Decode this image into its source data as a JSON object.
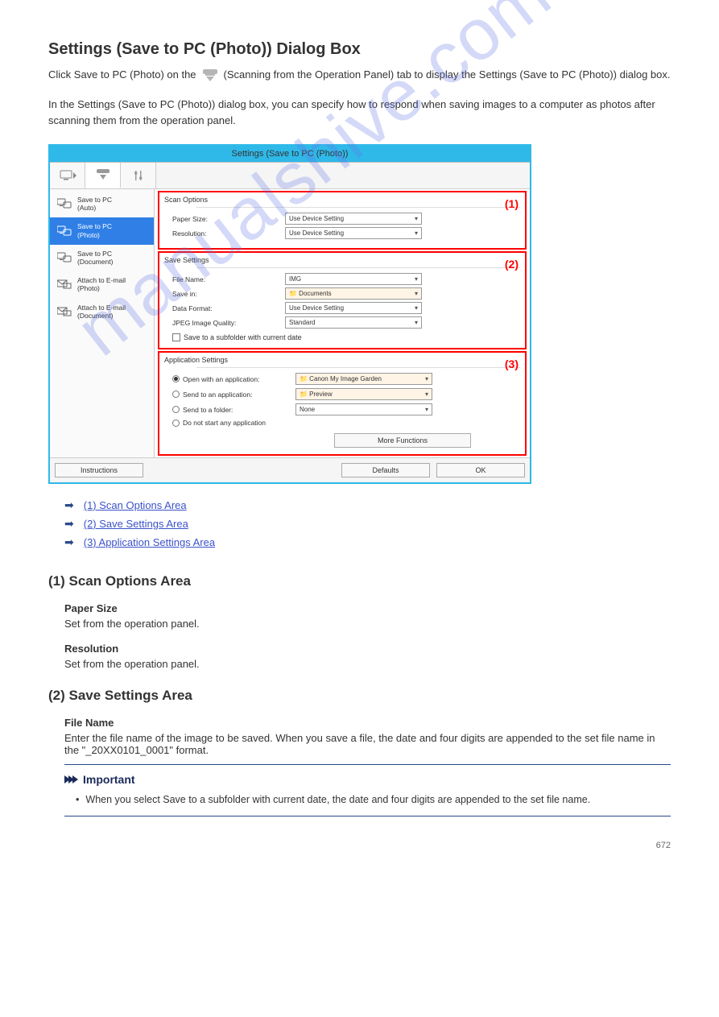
{
  "page_title": "Settings (Save to PC (Photo)) Dialog Box",
  "intro_line_prefix": "Click Save to PC (Photo) on the ",
  "intro_line_suffix": " (Scanning from the Operation Panel) tab to display the Settings (Save to PC (Photo)) dialog box.",
  "intro_para": "In the Settings (Save to PC (Photo)) dialog box, you can specify how to respond when saving images to a computer as photos after scanning them from the operation panel.",
  "dialog": {
    "title": "Settings (Save to PC (Photo))",
    "sidebar": [
      {
        "label": "Save to PC\n(Auto)",
        "type": "pc"
      },
      {
        "label": "Save to PC\n(Photo)",
        "type": "pc",
        "selected": true
      },
      {
        "label": "Save to PC\n(Document)",
        "type": "pc"
      },
      {
        "label": "Attach to E-mail\n(Photo)",
        "type": "mail"
      },
      {
        "label": "Attach to E-mail\n(Document)",
        "type": "mail"
      }
    ],
    "sections": [
      {
        "marker": "(1)",
        "title": "Scan Options",
        "rows": [
          {
            "label": "Paper Size:",
            "value": "Use Device Setting",
            "kind": "select"
          },
          {
            "label": "Resolution:",
            "value": "Use Device Setting",
            "kind": "select"
          }
        ]
      },
      {
        "marker": "(2)",
        "title": "Save Settings",
        "rows": [
          {
            "label": "File Name:",
            "value": "IMG",
            "kind": "combo"
          },
          {
            "label": "Save in:",
            "value": "Documents",
            "kind": "folder"
          },
          {
            "label": "Data Format:",
            "value": "Use Device Setting",
            "kind": "select"
          },
          {
            "label": "JPEG Image Quality:",
            "value": "Standard",
            "kind": "select"
          }
        ],
        "checkbox": "Save to a subfolder with current date"
      },
      {
        "marker": "(3)",
        "title": "Application Settings",
        "radios": [
          {
            "label": "Open with an application:",
            "value": "Canon My Image Garden",
            "kind": "folder",
            "checked": true
          },
          {
            "label": "Send to an application:",
            "value": "Preview",
            "kind": "folder"
          },
          {
            "label": "Send to a folder:",
            "value": "None",
            "kind": "plain"
          },
          {
            "label": "Do not start any application",
            "value": "",
            "kind": "none"
          }
        ],
        "more_functions": "More Functions"
      }
    ],
    "buttons": {
      "instructions": "Instructions",
      "defaults": "Defaults",
      "ok": "OK"
    }
  },
  "link_list": [
    "(1) Scan Options Area",
    "(2) Save Settings Area",
    "(3) Application Settings Area"
  ],
  "section1": {
    "heading": "(1) Scan Options Area",
    "fields": [
      {
        "name": "Paper Size",
        "desc": "Set from the operation panel."
      },
      {
        "name": "Resolution",
        "desc": "Set from the operation panel."
      }
    ]
  },
  "section2": {
    "heading": "(2) Save Settings Area",
    "fields": [
      {
        "name": "File Name",
        "desc": "Enter the file name of the image to be saved. When you save a file, the date and four digits are appended to the set file name in the \"_20XX0101_0001\" format."
      }
    ]
  },
  "important": {
    "label": "Important",
    "bullet": "When you select Save to a subfolder with current date, the date and four digits are appended to the set file name."
  },
  "watermark": "manualshive.com",
  "page_number": "672"
}
